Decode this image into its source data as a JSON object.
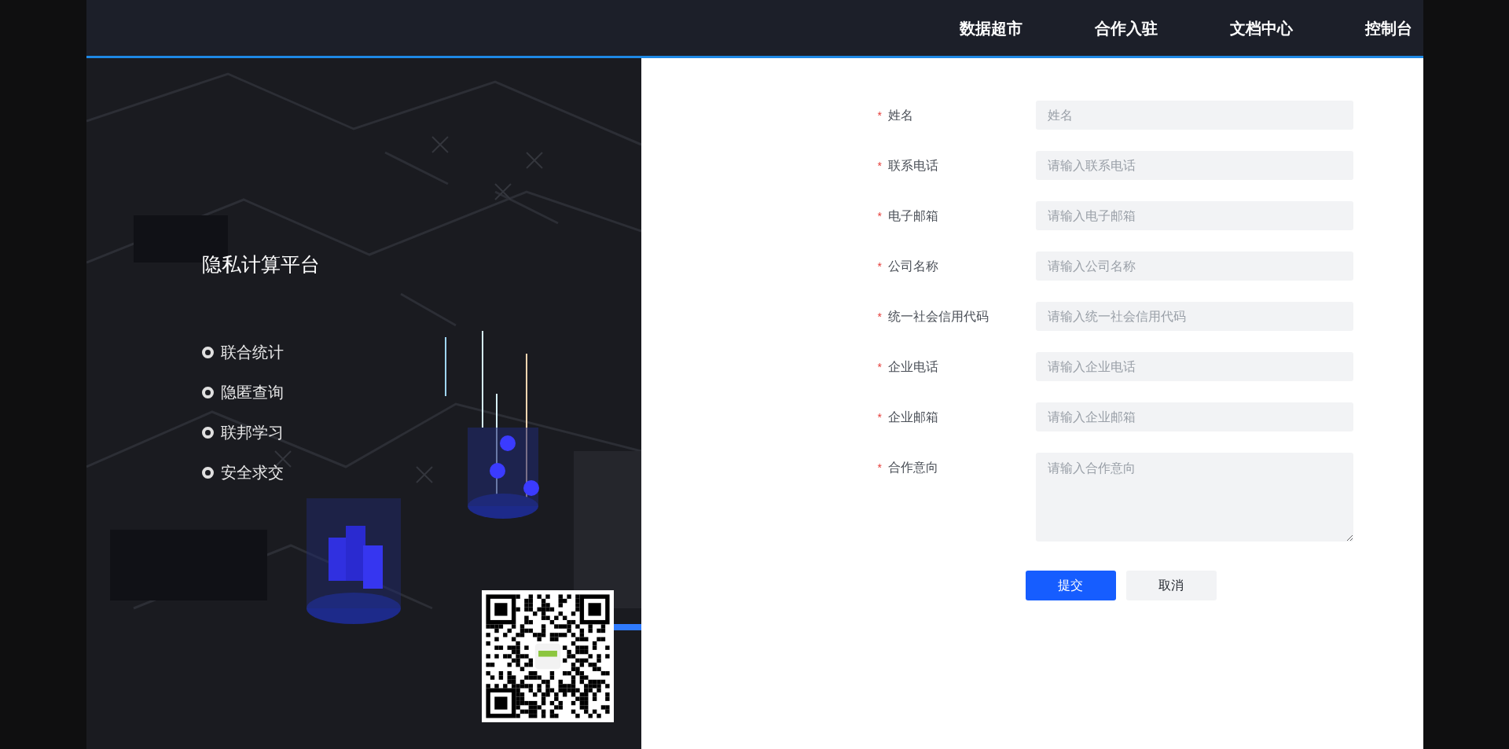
{
  "nav": {
    "items": [
      "数据超市",
      "合作入驻",
      "文档中心",
      "控制台"
    ]
  },
  "hero": {
    "title": "隐私计算平台",
    "features": [
      "联合统计",
      "隐匿查询",
      "联邦学习",
      "安全求交"
    ]
  },
  "form": {
    "fields": [
      {
        "label": "姓名",
        "placeholder": "姓名",
        "required_mark": "*",
        "kind": "input"
      },
      {
        "label": "联系电话",
        "placeholder": "请输入联系电话",
        "required_mark": "*",
        "kind": "input"
      },
      {
        "label": "电子邮箱",
        "placeholder": "请输入电子邮箱",
        "required_mark": "*",
        "kind": "input"
      },
      {
        "label": "公司名称",
        "placeholder": "请输入公司名称",
        "required_mark": "*",
        "kind": "input"
      },
      {
        "label": "统一社会信用代码",
        "placeholder": "请输入统一社会信用代码",
        "required_mark": "*",
        "kind": "input"
      },
      {
        "label": "企业电话",
        "placeholder": "请输入企业电话",
        "required_mark": "*",
        "kind": "input"
      },
      {
        "label": "企业邮箱",
        "placeholder": "请输入企业邮箱",
        "required_mark": "*",
        "kind": "input"
      },
      {
        "label": "合作意向",
        "placeholder": "请输入合作意向",
        "required_mark": "*",
        "kind": "textarea"
      }
    ],
    "buttons": [
      {
        "label": "提交",
        "kind": "primary"
      },
      {
        "label": "取消",
        "kind": "secondary"
      }
    ]
  }
}
